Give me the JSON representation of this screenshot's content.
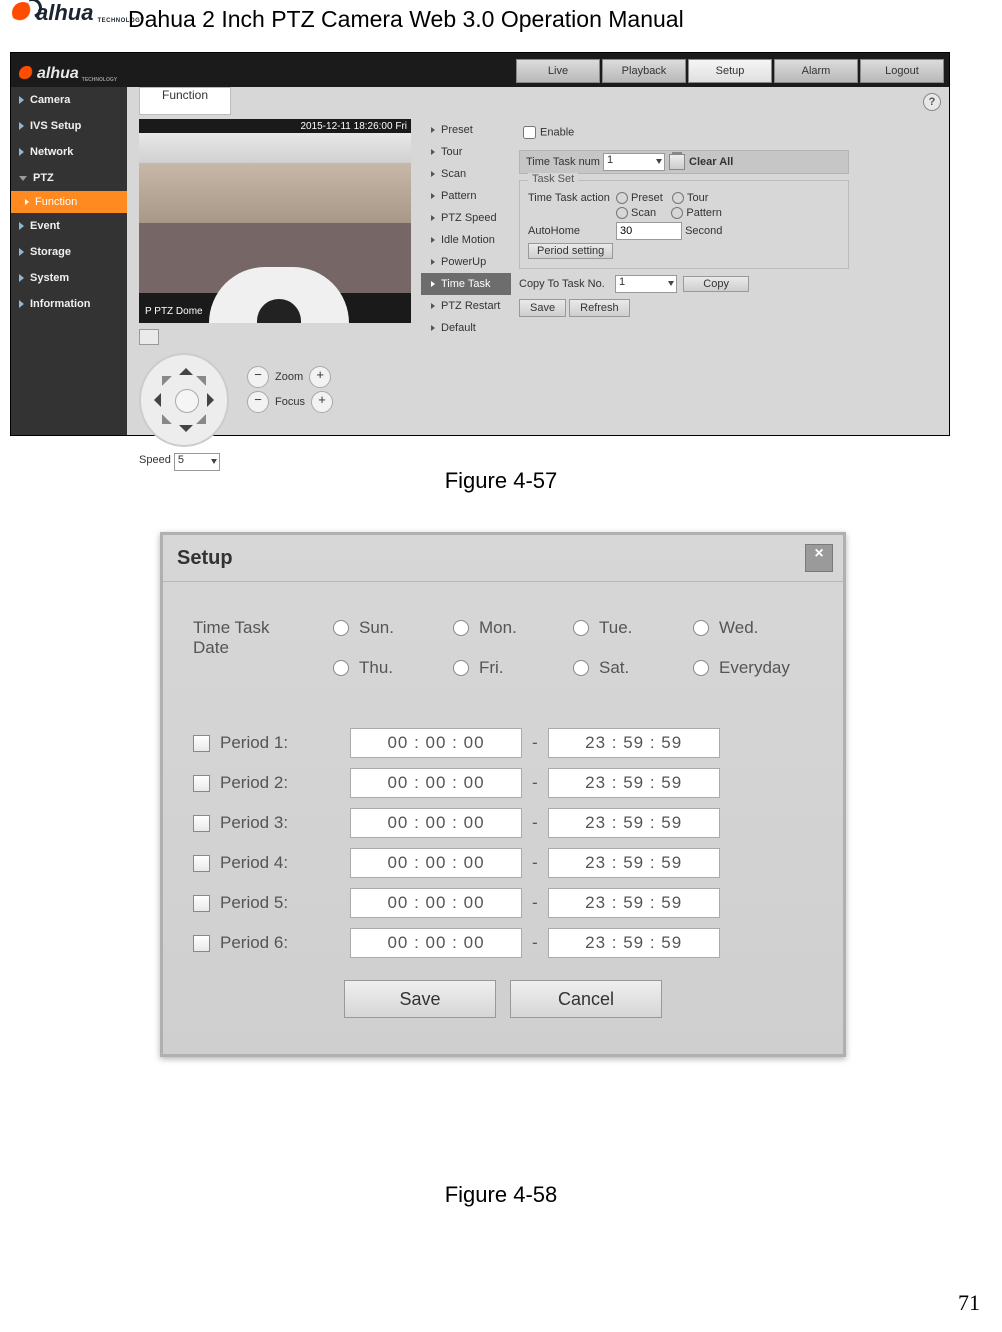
{
  "header": {
    "brand": "alhua",
    "brand_sub": "TECHNOLOGY",
    "title": "Dahua 2 Inch PTZ Camera Web 3.0 Operation Manual"
  },
  "page_number": "71",
  "shot1": {
    "brand": "alhua",
    "brand_sub": "TECHNOLOGY",
    "nav": {
      "live": "Live",
      "playback": "Playback",
      "setup": "Setup",
      "alarm": "Alarm",
      "logout": "Logout"
    },
    "sidebar": {
      "camera": "Camera",
      "ivs": "IVS Setup",
      "network": "Network",
      "ptz": "PTZ",
      "function": "Function",
      "event": "Event",
      "storage": "Storage",
      "system": "System",
      "information": "Information"
    },
    "func_tab": "Function",
    "help": "?",
    "preview": {
      "timestamp": "2015-12-11 18:26:00 Fri",
      "label": "P PTZ Dome"
    },
    "ptz_ctrl": {
      "zoom": "Zoom",
      "focus": "Focus",
      "minus": "−",
      "plus": "+",
      "speed_label": "Speed",
      "speed_val": "5"
    },
    "func_list": {
      "preset": "Preset",
      "tour": "Tour",
      "scan": "Scan",
      "pattern": "Pattern",
      "ptz_speed": "PTZ Speed",
      "idle_motion": "Idle Motion",
      "powerup": "PowerUp",
      "time_task": "Time Task",
      "ptz_restart": "PTZ Restart",
      "default": "Default"
    },
    "settings": {
      "enable": "Enable",
      "time_task_num_label": "Time Task num",
      "time_task_num_val": "1",
      "clear_all": "Clear All",
      "task_set_legend": "Task Set",
      "tta_label": "Time Task action",
      "preset": "Preset",
      "tour": "Tour",
      "scan": "Scan",
      "pattern": "Pattern",
      "autohome_label": "AutoHome",
      "autohome_val": "30",
      "autohome_unit": "Second",
      "period_setting": "Period setting",
      "copy_label": "Copy To Task No.",
      "copy_val": "1",
      "copy_btn": "Copy",
      "save": "Save",
      "refresh": "Refresh"
    }
  },
  "caption1": "Figure 4-57",
  "dialog": {
    "title": "Setup",
    "close": "×",
    "ttd_label": "Time Task\nDate",
    "days": {
      "sun": "Sun.",
      "mon": "Mon.",
      "tue": "Tue.",
      "wed": "Wed.",
      "thu": "Thu.",
      "fri": "Fri.",
      "sat": "Sat.",
      "every": "Everyday"
    },
    "periods": [
      {
        "label": "Period 1:",
        "from": "00  :  00  :  00",
        "to": "23  :  59  :  59"
      },
      {
        "label": "Period 2:",
        "from": "00  :  00  :  00",
        "to": "23  :  59  :  59"
      },
      {
        "label": "Period 3:",
        "from": "00  :  00  :  00",
        "to": "23  :  59  :  59"
      },
      {
        "label": "Period 4:",
        "from": "00  :  00  :  00",
        "to": "23  :  59  :  59"
      },
      {
        "label": "Period 5:",
        "from": "00  :  00  :  00",
        "to": "23  :  59  :  59"
      },
      {
        "label": "Period 6:",
        "from": "00  :  00  :  00",
        "to": "23  :  59  :  59"
      }
    ],
    "save": "Save",
    "cancel": "Cancel"
  },
  "caption2": "Figure 4-58"
}
